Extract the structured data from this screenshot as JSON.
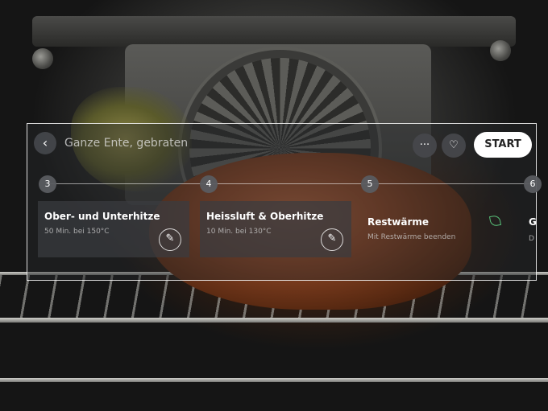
{
  "recipe": {
    "back_icon": "chevron-left-icon",
    "title": "Ganze Ente, gebraten",
    "more_icon": "more-dots-icon",
    "favorite_icon": "heart-icon",
    "start_label": "START"
  },
  "steps": [
    {
      "number": "3",
      "title": "Ober- und Unterhitze",
      "detail": "50 Min. bei 150°C",
      "edit_icon": "pencil-icon"
    },
    {
      "number": "4",
      "title": "Heissluft & Oberhitze",
      "detail": "10 Min. bei 130°C",
      "edit_icon": "pencil-icon"
    },
    {
      "number": "5",
      "title": "Restwärme",
      "detail": "Mit Restwärme beenden",
      "status_icon": "leaf-icon",
      "status_color": "#59c27a"
    },
    {
      "number": "6",
      "title": "G",
      "detail": "D"
    }
  ]
}
